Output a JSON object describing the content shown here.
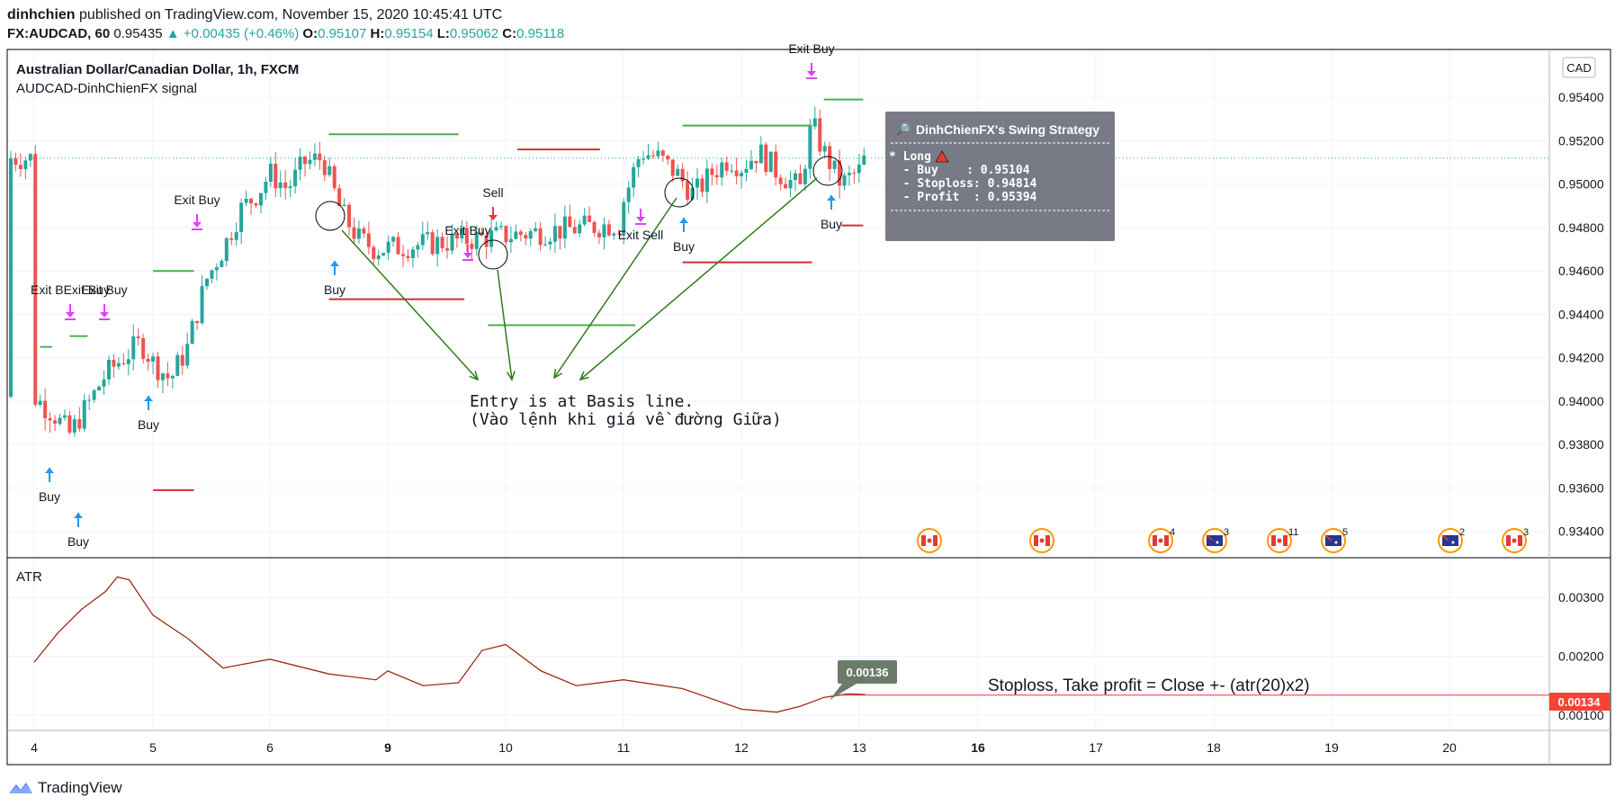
{
  "header": {
    "author": "dinhchien",
    "published_text": "published on TradingView.com, November 15, 2020 10:45:41 UTC",
    "symbol": "FX:AUDCAD, 60",
    "last": "0.95435",
    "change": "+0.00435 (+0.46%)",
    "o_label": "O:",
    "o": "0.95107",
    "h_label": "H:",
    "h": "0.95154",
    "l_label": "L:",
    "l": "0.95062",
    "c_label": "C:",
    "c": "0.95118"
  },
  "legend": {
    "title": "Australian Dollar/Canadian Dollar, 1h, FXCM",
    "indicator": "AUDCAD-DinhChienFX signal",
    "currency_button": "CAD"
  },
  "strategy_box": {
    "title": "DinhChienFX's Swing Strategy",
    "lines": [
      "* Long",
      "  - Buy    : 0.95104",
      "  - Stoploss: 0.94814",
      "  - Profit  : 0.95394"
    ]
  },
  "annotations": {
    "entry_line1": "Entry is at Basis line.",
    "entry_line2": "(Vào lệnh khi giá về đường Giữa)",
    "stoploss_note": "Stoploss, Take profit = Close +- (atr(20)x2)"
  },
  "signals": [
    {
      "text": "Exit BExit Buy",
      "kind": "exit"
    },
    {
      "text": "Exit Buy",
      "kind": "exit"
    },
    {
      "text": "Buy",
      "kind": "buy"
    },
    {
      "text": "Buy",
      "kind": "buy"
    },
    {
      "text": "Buy",
      "kind": "buy"
    },
    {
      "text": "Exit Buy",
      "kind": "exit"
    },
    {
      "text": "Buy",
      "kind": "buy"
    },
    {
      "text": "Exit Buy",
      "kind": "exit"
    },
    {
      "text": "Sell",
      "kind": "sell"
    },
    {
      "text": "Exit Sell",
      "kind": "exit"
    },
    {
      "text": "Buy",
      "kind": "buy"
    },
    {
      "text": "Exit Buy",
      "kind": "exit"
    },
    {
      "text": "Buy",
      "kind": "buy"
    }
  ],
  "event_badges": [
    {
      "flag": "CA",
      "count": ""
    },
    {
      "flag": "CA",
      "count": ""
    },
    {
      "flag": "CA",
      "count": "4"
    },
    {
      "flag": "AU",
      "count": "3"
    },
    {
      "flag": "CA",
      "count": "11"
    },
    {
      "flag": "AU",
      "count": "5"
    },
    {
      "flag": "AU",
      "count": "2"
    },
    {
      "flag": "CA",
      "count": "3"
    }
  ],
  "atr_panel": {
    "label": "ATR",
    "current_value": "0.00134",
    "tooltip_value": "0.00136",
    "ticks": [
      "0.00300",
      "0.00200",
      "0.00100"
    ]
  },
  "footer": {
    "brand": "TradingView"
  },
  "colors": {
    "up": "#26a69a",
    "down": "#ef5350",
    "tp_line": "#4caf50",
    "sl_line": "#d32f2f",
    "arrow_annot": "#2e7d1c",
    "atr_line": "#9c2a16",
    "exit_marker": "#e040fb",
    "buy_marker": "#2196f3",
    "sell_marker": "#e53935",
    "tooltip_bg": "#6b7b69"
  },
  "chart_data": [
    {
      "type": "candlestick",
      "title": "Australian Dollar/Canadian Dollar, 1h, FXCM",
      "x_ticks": [
        "4",
        "5",
        "6",
        "9",
        "10",
        "11",
        "12",
        "13",
        "16",
        "17",
        "18",
        "19",
        "20"
      ],
      "y_ticks": [
        "0.95400",
        "0.95200",
        "0.95000",
        "0.94800",
        "0.94600",
        "0.94400",
        "0.94200",
        "0.94000",
        "0.93800",
        "0.93600",
        "0.93400"
      ],
      "ylim": [
        0.9332,
        0.956
      ],
      "close_path": [
        [
          4.0,
          0.9402
        ],
        [
          4.15,
          0.9395
        ],
        [
          4.3,
          0.9385
        ],
        [
          4.45,
          0.9398
        ],
        [
          4.6,
          0.9412
        ],
        [
          4.75,
          0.942
        ],
        [
          4.9,
          0.9427
        ],
        [
          5.0,
          0.9418
        ],
        [
          5.15,
          0.941
        ],
        [
          5.3,
          0.9425
        ],
        [
          5.45,
          0.9455
        ],
        [
          5.6,
          0.947
        ],
        [
          5.75,
          0.9488
        ],
        [
          5.9,
          0.9496
        ],
        [
          6.0,
          0.9505
        ],
        [
          6.15,
          0.9498
        ],
        [
          6.3,
          0.951
        ],
        [
          6.45,
          0.9512
        ],
        [
          6.6,
          0.9488
        ],
        [
          6.75,
          0.9475
        ],
        [
          6.9,
          0.947
        ],
        [
          9.0,
          0.9482
        ],
        [
          9.15,
          0.9478
        ],
        [
          9.3,
          0.9475
        ],
        [
          9.45,
          0.9505
        ],
        [
          9.6,
          0.946
        ],
        [
          9.7,
          0.945
        ],
        [
          9.85,
          0.947
        ],
        [
          10.0,
          0.9478
        ],
        [
          10.15,
          0.947
        ],
        [
          10.3,
          0.9476
        ],
        [
          10.45,
          0.9482
        ],
        [
          10.6,
          0.9462
        ],
        [
          10.8,
          0.9468
        ],
        [
          11.0,
          0.9492
        ],
        [
          11.15,
          0.9515
        ],
        [
          11.3,
          0.9512
        ],
        [
          11.45,
          0.9505
        ],
        [
          11.6,
          0.9495
        ],
        [
          11.75,
          0.9505
        ],
        [
          11.9,
          0.9512
        ],
        [
          12.0,
          0.9508
        ],
        [
          12.15,
          0.9515
        ],
        [
          12.3,
          0.9506
        ],
        [
          12.5,
          0.9498
        ],
        [
          12.6,
          0.9528
        ],
        [
          12.7,
          0.9515
        ],
        [
          12.85,
          0.95
        ],
        [
          13.0,
          0.9506
        ],
        [
          13.15,
          0.9512
        ]
      ],
      "lines_take_profit": [
        {
          "x": [
            5.0,
            5.35
          ],
          "y": 0.946
        },
        {
          "x": [
            6.5,
            7.6
          ],
          "y": 0.9523
        },
        {
          "x": [
            11.5,
            12.6
          ],
          "y": 0.9527
        },
        {
          "x": [
            12.7,
            13.1
          ],
          "y": 0.9539
        },
        {
          "x": [
            9.85,
            11.1
          ],
          "y": 0.9435
        },
        {
          "x": [
            4.05,
            4.15
          ],
          "y": 0.9425
        },
        {
          "x": [
            4.3,
            4.45
          ],
          "y": 0.943
        }
      ],
      "lines_stop_loss": [
        {
          "x": [
            5.0,
            5.35
          ],
          "y": 0.9359
        },
        {
          "x": [
            6.5,
            7.65
          ],
          "y": 0.9447
        },
        {
          "x": [
            8.8,
            10.1
          ],
          "y": 0.9516
        },
        {
          "x": [
            11.5,
            12.6
          ],
          "y": 0.9464
        },
        {
          "x": [
            12.85,
            13.1
          ],
          "y": 0.9481
        }
      ],
      "last_price_line": 0.9512
    },
    {
      "type": "line",
      "title": "ATR",
      "y_ticks": [
        "0.00300",
        "0.00200",
        "0.00100"
      ],
      "ylim": [
        0.0008,
        0.0036
      ],
      "x": [
        4.0,
        4.2,
        4.4,
        4.6,
        4.7,
        4.8,
        5.0,
        5.3,
        5.6,
        6.0,
        6.5,
        6.9,
        9.0,
        9.3,
        9.6,
        9.8,
        10.0,
        10.3,
        10.6,
        11.0,
        11.5,
        12.0,
        12.3,
        12.5,
        12.7,
        12.9,
        13.15
      ],
      "values": [
        0.0019,
        0.0024,
        0.0028,
        0.0031,
        0.00335,
        0.0033,
        0.0027,
        0.0023,
        0.0018,
        0.00195,
        0.0017,
        0.0016,
        0.00175,
        0.0015,
        0.00155,
        0.0021,
        0.0022,
        0.00175,
        0.0015,
        0.0016,
        0.00145,
        0.0011,
        0.00105,
        0.00115,
        0.0013,
        0.00136,
        0.00135
      ],
      "current_value": 0.00134
    }
  ]
}
